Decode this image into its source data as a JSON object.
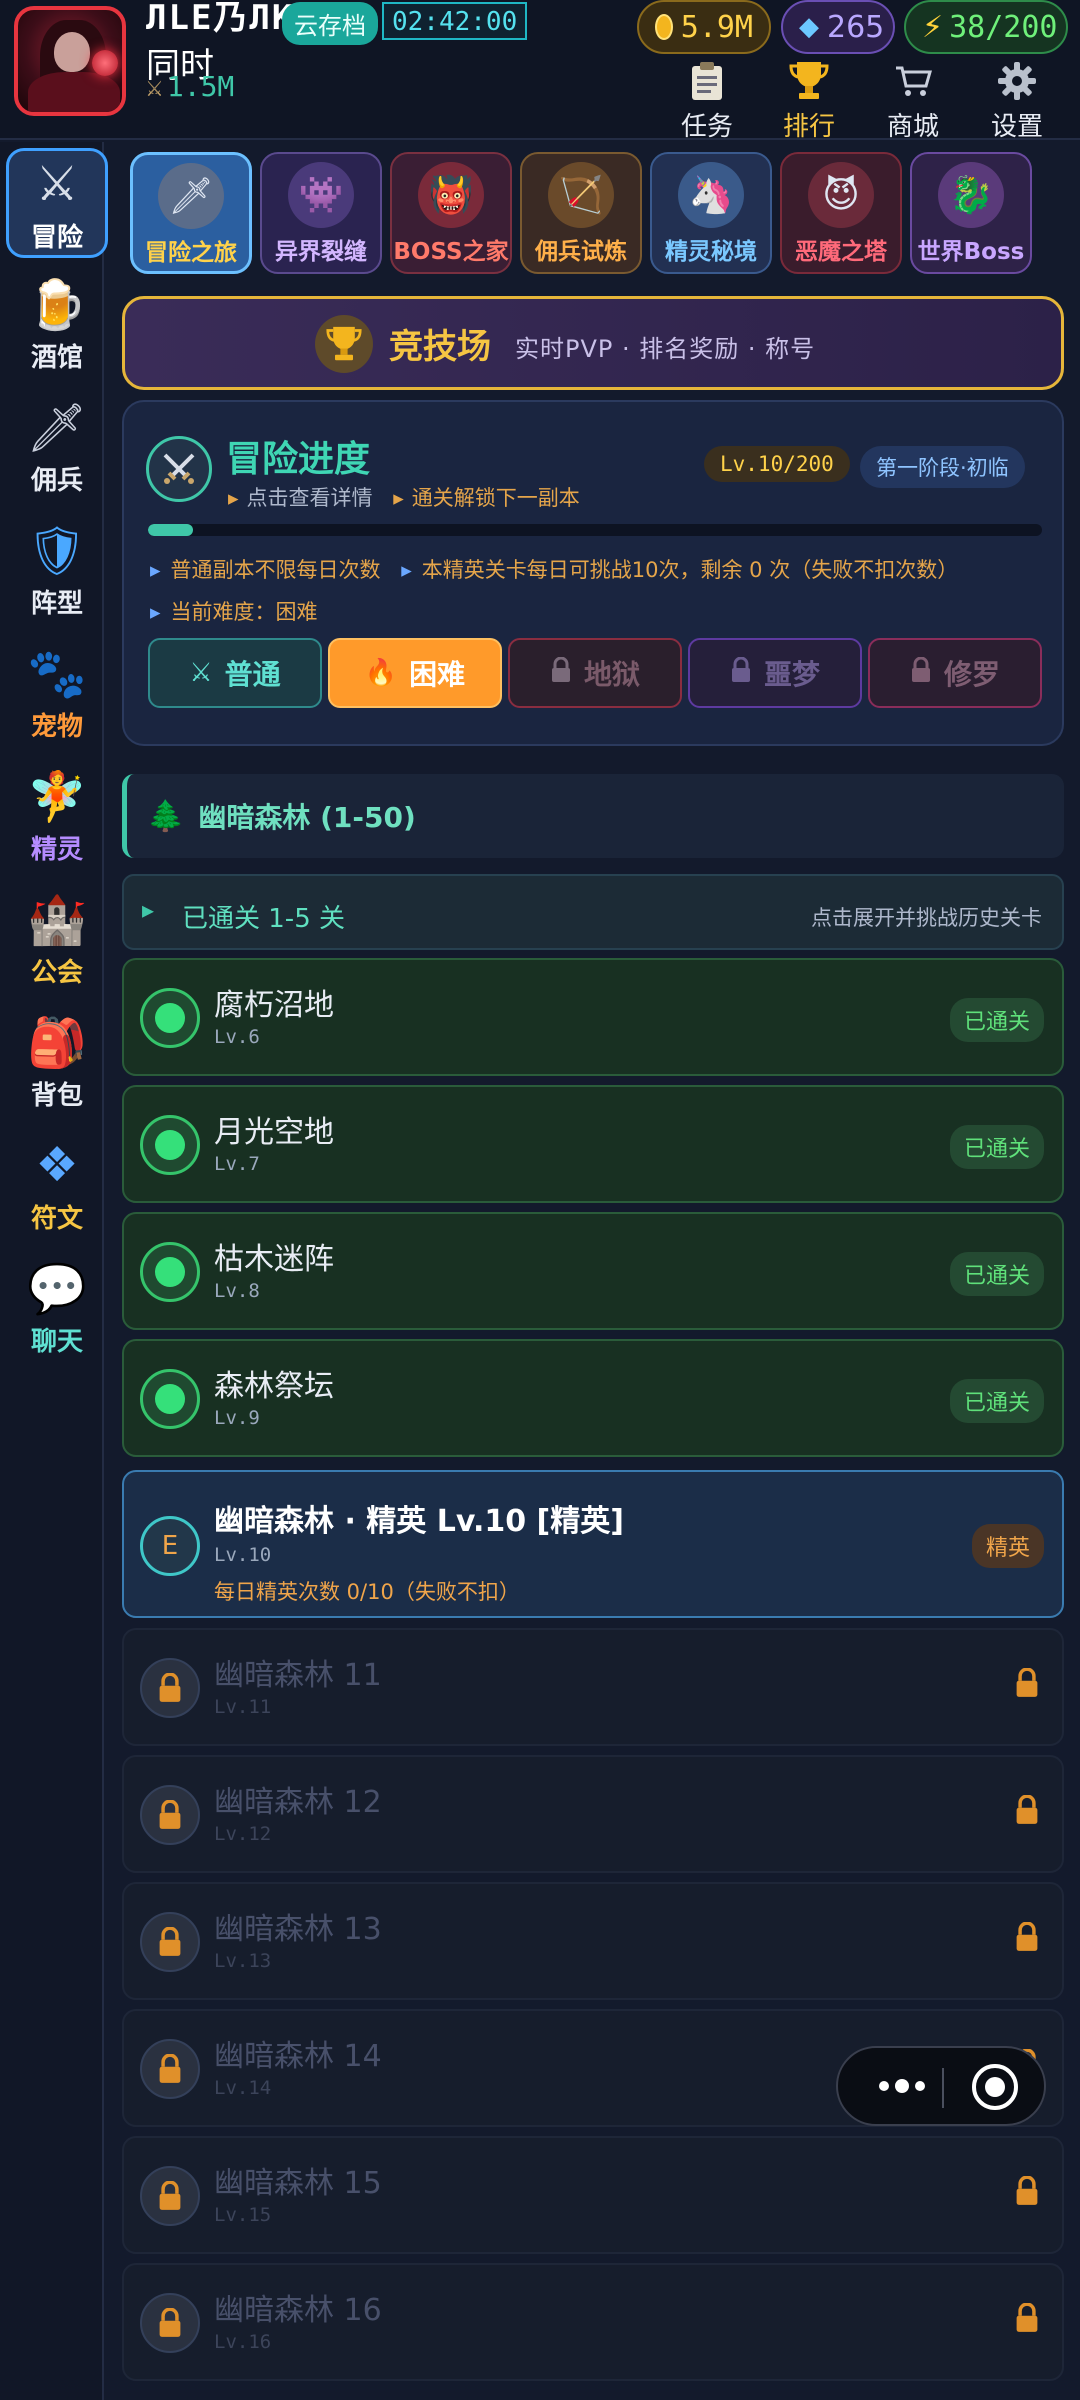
{
  "header": {
    "player_name": "ЛLЕ乃ЛK",
    "cloud_save": "云存档",
    "timer": "02:42:00",
    "player_line2": "同时",
    "power": "1.5M",
    "resources": {
      "gold": "5.9M",
      "gems": "265",
      "energy": "38/200"
    },
    "nav": {
      "task": "任务",
      "rank": "排行",
      "shop": "商城",
      "settings": "设置"
    }
  },
  "sidebar": {
    "items": [
      {
        "label": "冒险",
        "color": "#ffffff"
      },
      {
        "label": "酒馆",
        "color": "#e8ecf4"
      },
      {
        "label": "佣兵",
        "color": "#e8ecf4"
      },
      {
        "label": "阵型",
        "color": "#e8ecf4"
      },
      {
        "label": "宠物",
        "color": "#ff9a3a"
      },
      {
        "label": "精灵",
        "color": "#b58cff"
      },
      {
        "label": "公会",
        "color": "#f6c543"
      },
      {
        "label": "背包",
        "color": "#e8ecf4"
      },
      {
        "label": "符文",
        "color": "#f6c543"
      },
      {
        "label": "聊天",
        "color": "#5fe0d2"
      }
    ]
  },
  "tabs": [
    {
      "label": "冒险之旅",
      "color": "#ffd24a"
    },
    {
      "label": "异界裂缝",
      "color": "#d3b6ff"
    },
    {
      "label": "BOSS之家",
      "color": "#ff7a6a"
    },
    {
      "label": "佣兵试炼",
      "color": "#ffb04a"
    },
    {
      "label": "精灵秘境",
      "color": "#7ac8ff"
    },
    {
      "label": "恶魔之塔",
      "color": "#ff6a7a"
    },
    {
      "label": "世界Boss",
      "color": "#c9a6ff"
    }
  ],
  "arena": {
    "title": "竞技场",
    "desc": "实时PVP  ·  排名奖励  ·  称号"
  },
  "progress": {
    "title": "冒险进度",
    "sub_detail": "点击查看详情",
    "sub_unlock": "通关解锁下一副本",
    "level": "Lv.10/200",
    "stage": "第一阶段·初临",
    "progress_fraction": 0.05,
    "note1_a": "普通副本不限每日次数",
    "note1_b": "本精英关卡每日可挑战10次，剩余 0 次（失败不扣次数）",
    "note2": "当前难度：困难",
    "difficulties": {
      "normal": "普通",
      "hard": "困难",
      "hell": "地狱",
      "nightmare": "噩梦",
      "asura": "修罗"
    }
  },
  "zone": {
    "title": "幽暗森林 (1-50)",
    "cleared_text": "已通关 1-5 关",
    "cleared_hint": "点击展开并挑战历史关卡"
  },
  "stages": {
    "done": [
      {
        "name": "腐朽沼地",
        "lv": "Lv.6",
        "badge": "已通关"
      },
      {
        "name": "月光空地",
        "lv": "Lv.7",
        "badge": "已通关"
      },
      {
        "name": "枯木迷阵",
        "lv": "Lv.8",
        "badge": "已通关"
      },
      {
        "name": "森林祭坛",
        "lv": "Lv.9",
        "badge": "已通关"
      }
    ],
    "elite": {
      "icon": "E",
      "name": "幽暗森林 · 精英 Lv.10 [精英]",
      "lv": "Lv.10",
      "daily": "每日精英次数 0/10（失败不扣）",
      "badge": "精英"
    },
    "locked": [
      {
        "name": "幽暗森林 11",
        "lv": "Lv.11"
      },
      {
        "name": "幽暗森林 12",
        "lv": "Lv.12"
      },
      {
        "name": "幽暗森林 13",
        "lv": "Lv.13"
      },
      {
        "name": "幽暗森林 14",
        "lv": "Lv.14"
      },
      {
        "name": "幽暗森林 15",
        "lv": "Lv.15"
      },
      {
        "name": "幽暗森林 16",
        "lv": "Lv.16"
      }
    ]
  },
  "icons": {
    "sidebar": [
      "crossed-swords-icon",
      "beer-mug-icon",
      "dagger-icon",
      "shield-icon",
      "paw-icon",
      "fairy-icon",
      "castle-icon",
      "backpack-icon",
      "diamond-rune-icon",
      "chat-bubble-icon"
    ],
    "tabs": [
      "sword-icon",
      "golem-icon",
      "boss-icon",
      "mercenary-icon",
      "unicorn-icon",
      "demon-icon",
      "dragon-icon"
    ]
  }
}
